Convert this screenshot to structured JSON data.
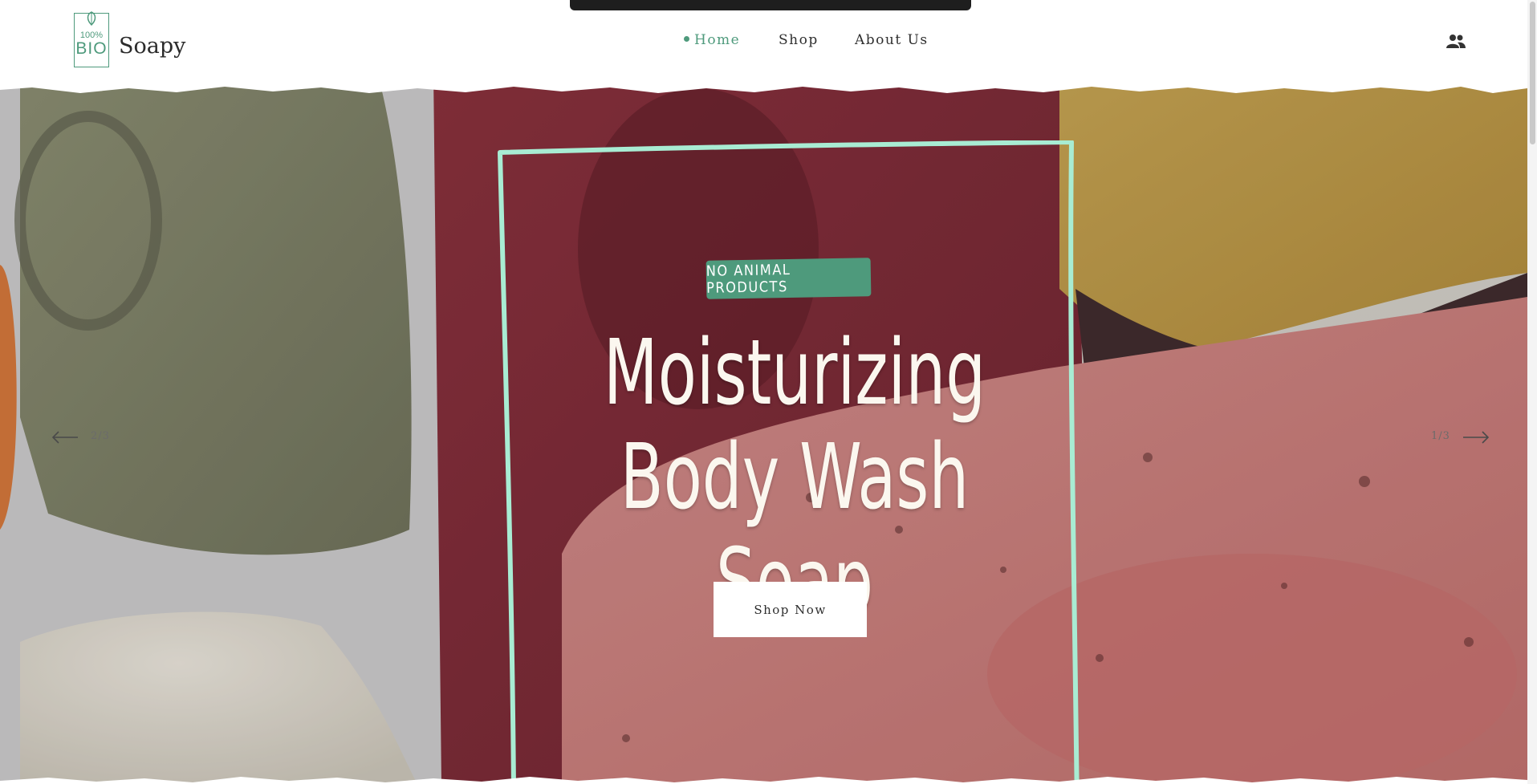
{
  "brand": {
    "logo_percent": "100%",
    "logo_bio": "BIO",
    "name": "Soapy"
  },
  "nav": {
    "items": [
      {
        "label": "Home",
        "active": true
      },
      {
        "label": "Shop",
        "active": false
      },
      {
        "label": "About Us",
        "active": false
      }
    ]
  },
  "header_icons": {
    "account": "users-icon"
  },
  "hero": {
    "badge": "NO ANIMAL PRODUCTS",
    "headline_line1": "Moisturizing",
    "headline_line2": "Body Wash Soap",
    "cta": "Shop Now",
    "prev_count": "2/3",
    "next_count": "1/3"
  },
  "colors": {
    "accent": "#4e9a7c",
    "frame": "#a8ecd3",
    "headline": "#fbf7ef"
  }
}
